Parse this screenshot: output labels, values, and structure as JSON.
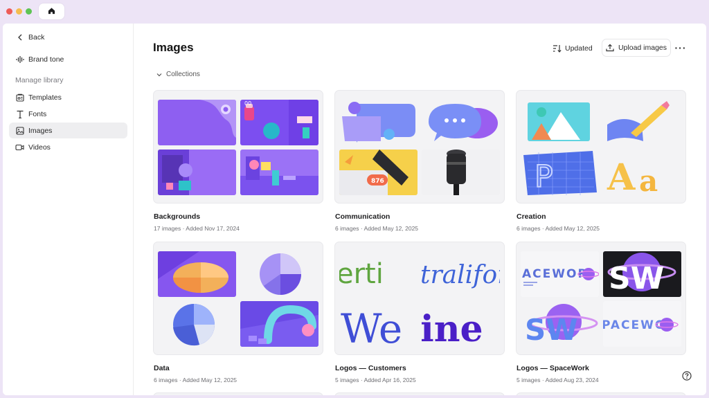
{
  "window": {
    "home_tab_icon": "home-icon"
  },
  "sidebar": {
    "back_label": "Back",
    "brand_tone_label": "Brand tone",
    "section_heading": "Manage library",
    "items": [
      {
        "label": "Templates",
        "icon": "templates-icon",
        "active": false
      },
      {
        "label": "Fonts",
        "icon": "fonts-icon",
        "active": false
      },
      {
        "label": "Images",
        "icon": "image-icon",
        "active": true
      },
      {
        "label": "Videos",
        "icon": "video-icon",
        "active": false
      }
    ]
  },
  "header": {
    "title": "Images",
    "sort_label": "Updated",
    "upload_label": "Upload images",
    "more_label": "···"
  },
  "collections": {
    "toggle_label": "Collections",
    "cards": [
      {
        "title": "Backgrounds",
        "meta": "17 images · Added Nov 17, 2024"
      },
      {
        "title": "Communication",
        "meta": "6 images · Added May 12, 2025"
      },
      {
        "title": "Creation",
        "meta": "6 images · Added May 12, 2025"
      },
      {
        "title": "Data",
        "meta": "6 images · Added May 12, 2025"
      },
      {
        "title": "Logos — Customers",
        "meta": "5 images · Added Apr 16, 2025"
      },
      {
        "title": "Logos — SpaceWork",
        "meta": "5 images · Added Aug 23, 2024"
      }
    ]
  },
  "thumb_text": {
    "notification_count": "876",
    "logo_word_1": "erti",
    "logo_word_2": "traliform",
    "logo_word_3": "We",
    "logo_word_4": "ine",
    "spacework_1": "ACEWOR",
    "spacework_2": "SW",
    "spacework_3": "SW",
    "spacework_4": "PACEWO"
  },
  "colors": {
    "accent_purple": "#8b5cf6",
    "sidebar_active": "#eeeef0"
  }
}
